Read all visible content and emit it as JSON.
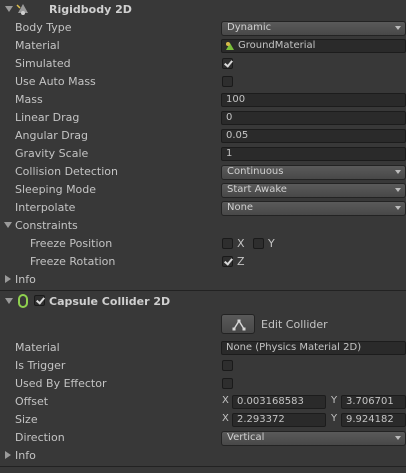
{
  "rigidbody": {
    "title": "Rigidbody 2D",
    "fields": {
      "body_type_label": "Body Type",
      "body_type_value": "Dynamic",
      "material_label": "Material",
      "material_value": "GroundMaterial",
      "simulated_label": "Simulated",
      "simulated_checked": true,
      "use_auto_mass_label": "Use Auto Mass",
      "use_auto_mass_checked": false,
      "mass_label": "Mass",
      "mass_value": "100",
      "linear_drag_label": "Linear Drag",
      "linear_drag_value": "0",
      "angular_drag_label": "Angular Drag",
      "angular_drag_value": "0.05",
      "gravity_scale_label": "Gravity Scale",
      "gravity_scale_value": "1",
      "collision_detection_label": "Collision Detection",
      "collision_detection_value": "Continuous",
      "sleeping_mode_label": "Sleeping Mode",
      "sleeping_mode_value": "Start Awake",
      "interpolate_label": "Interpolate",
      "interpolate_value": "None"
    },
    "constraints": {
      "label": "Constraints",
      "freeze_position_label": "Freeze Position",
      "freeze_position_x_label": "X",
      "freeze_position_x_checked": false,
      "freeze_position_y_label": "Y",
      "freeze_position_y_checked": false,
      "freeze_rotation_label": "Freeze Rotation",
      "freeze_rotation_z_label": "Z",
      "freeze_rotation_z_checked": true
    },
    "info_label": "Info"
  },
  "capsule_collider": {
    "title": "Capsule Collider 2D",
    "enabled": true,
    "edit_collider_label": "Edit Collider",
    "material_label": "Material",
    "material_value": "None (Physics Material 2D)",
    "is_trigger_label": "Is Trigger",
    "is_trigger_checked": false,
    "used_by_effector_label": "Used By Effector",
    "used_by_effector_checked": false,
    "offset_label": "Offset",
    "offset_x_label": "X",
    "offset_x": "0.003168583",
    "offset_y_label": "Y",
    "offset_y": "3.706701",
    "size_label": "Size",
    "size_x_label": "X",
    "size_x": "2.293372",
    "size_y_label": "Y",
    "size_y": "9.924182",
    "direction_label": "Direction",
    "direction_value": "Vertical",
    "info_label": "Info"
  },
  "icons": {
    "rigidbody": "rigidbody-icon",
    "material": "physics-material-icon",
    "capsule": "capsule-collider-icon",
    "edit": "edit-collider-icon"
  },
  "colors": {
    "background": "#383838",
    "text": "#c4c4c4",
    "field": "#2a2a2a",
    "material_icon": "#7bbf3a",
    "capsule_icon": "#8fd14f"
  }
}
